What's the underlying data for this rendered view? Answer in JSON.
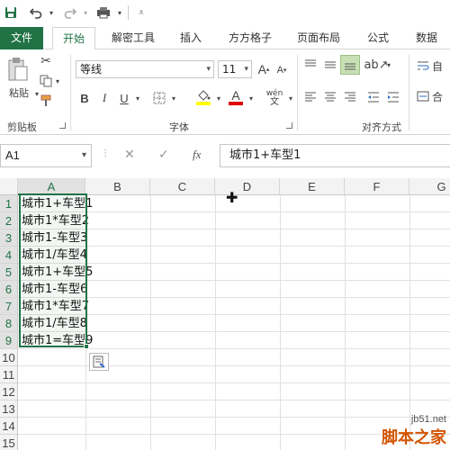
{
  "quick_access": {
    "icons": [
      "save-icon",
      "undo-icon",
      "redo-icon",
      "print-preview-icon",
      "customize-icon"
    ]
  },
  "tabs": [
    {
      "label": "文件"
    },
    {
      "label": "开始"
    },
    {
      "label": "解密工具"
    },
    {
      "label": "插入"
    },
    {
      "label": "方方格子"
    },
    {
      "label": "页面布局"
    },
    {
      "label": "公式"
    },
    {
      "label": "数据"
    }
  ],
  "ribbon": {
    "clipboard": {
      "paste_label": "粘贴",
      "group_label": "剪贴板"
    },
    "font": {
      "font_name": "等线",
      "font_size": "11",
      "grow_label": "A",
      "shrink_label": "A",
      "bold": "B",
      "italic": "I",
      "underline": "U",
      "font_color": "A",
      "phonetic": "wén",
      "group_label": "字体",
      "fill_color": "#ffff00",
      "font_color_value": "#e00000"
    },
    "alignment": {
      "group_label": "对齐方式",
      "wrap_label": "自",
      "merge_label": "合"
    }
  },
  "formula_bar": {
    "name_box": "A1",
    "cancel": "✕",
    "enter": "✓",
    "fx": "fx",
    "value": "城市1+车型1"
  },
  "grid": {
    "columns": [
      "A",
      "B",
      "C",
      "D",
      "E",
      "F",
      "G"
    ],
    "rows": [
      "1",
      "2",
      "3",
      "4",
      "5",
      "6",
      "7",
      "8",
      "9",
      "10",
      "11",
      "12",
      "13",
      "14",
      "15"
    ],
    "cells": [
      "城市1+车型1",
      "城市1*车型2",
      "城市1-车型3",
      "城市1/车型4",
      "城市1+车型5",
      "城市1-车型6",
      "城市1*车型7",
      "城市1/车型8",
      "城市1=车型9"
    ],
    "selected_column": "A"
  },
  "colors": {
    "accent": "#217346"
  },
  "watermark": {
    "url": "jb51.net",
    "brand": "脚本之家"
  }
}
